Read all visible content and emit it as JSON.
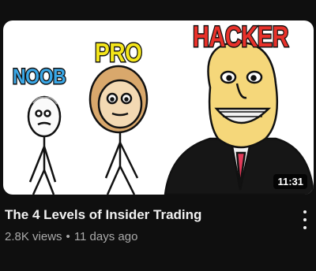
{
  "video": {
    "title": "The 4 Levels of Insider Trading",
    "views": "2.8K views",
    "age": "11 days ago",
    "duration": "11:31"
  },
  "thumbnail": {
    "labels": {
      "noob": "NOOB",
      "pro": "PRO",
      "hacker": "HACKER"
    },
    "colors": {
      "noob": "#3aa7e6",
      "pro": "#f4e61a",
      "hacker": "#e8312a"
    }
  },
  "icons": {
    "more": "more-vertical-icon"
  }
}
